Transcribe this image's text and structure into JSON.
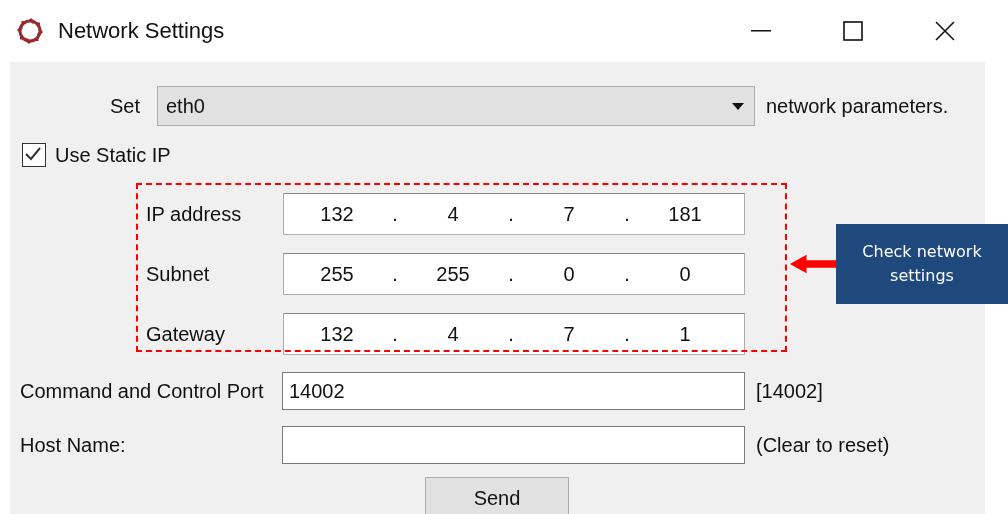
{
  "window": {
    "title": "Network Settings"
  },
  "interface_row": {
    "label": "Set",
    "value": "eth0",
    "suffix": "network parameters."
  },
  "static_ip": {
    "label": "Use Static IP",
    "checked": true
  },
  "addresses": [
    {
      "label": "IP address",
      "octets": [
        "132",
        "4",
        "7",
        "181"
      ],
      "separators": [
        ".",
        ".",
        "."
      ]
    },
    {
      "label": "Subnet",
      "octets": [
        "255",
        "255",
        "0",
        "0"
      ],
      "separators": [
        ".",
        ".",
        "."
      ]
    },
    {
      "label": "Gateway",
      "octets": [
        "132",
        "4",
        "7",
        "1"
      ],
      "separators": [
        ".",
        ".",
        "."
      ]
    }
  ],
  "port": {
    "label": "Command and Control Port",
    "value": "14002",
    "hint": "[14002]"
  },
  "host": {
    "label": "Host Name:",
    "hint": "(Clear to reset)"
  },
  "send_button": "Send",
  "callout": {
    "text": "Check network settings"
  }
}
